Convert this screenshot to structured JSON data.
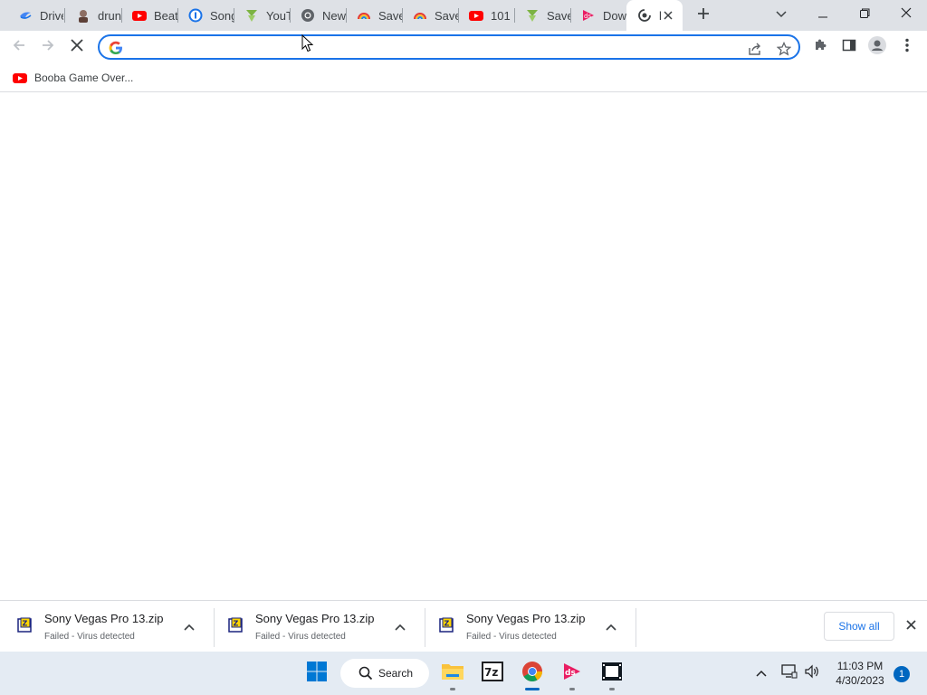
{
  "tabs": [
    {
      "label": "Drive",
      "icon": "drive-icon"
    },
    {
      "label": "drunk",
      "icon": "avatar-icon"
    },
    {
      "label": "Beat",
      "icon": "youtube-icon"
    },
    {
      "label": "Song",
      "icon": "onepassword-icon"
    },
    {
      "label": "YouT",
      "icon": "download-arrow-icon"
    },
    {
      "label": "New",
      "icon": "chrome-icon"
    },
    {
      "label": "Save",
      "icon": "rainbow-icon"
    },
    {
      "label": "Save",
      "icon": "rainbow-icon"
    },
    {
      "label": "101",
      "icon": "youtube-icon"
    },
    {
      "label": "Save",
      "icon": "download-arrow-icon"
    },
    {
      "label": "Dow",
      "icon": "ds-icon"
    },
    {
      "label": "l",
      "icon": "loading-icon",
      "active": true
    }
  ],
  "omnibox": {
    "value": "",
    "placeholder": ""
  },
  "bookmarks": [
    {
      "label": "Booba Game Over...",
      "icon": "youtube-icon"
    }
  ],
  "downloads": [
    {
      "name": "Sony Vegas Pro 13.zip",
      "status": "Failed - Virus detected"
    },
    {
      "name": "Sony Vegas Pro 13.zip",
      "status": "Failed - Virus detected"
    },
    {
      "name": "Sony Vegas Pro 13.zip",
      "status": "Failed - Virus detected"
    }
  ],
  "shelf": {
    "show_all_label": "Show all"
  },
  "taskbar": {
    "search_label": "Search",
    "time": "11:03 PM",
    "date": "4/30/2023",
    "notification_count": "1"
  },
  "colors": {
    "accent": "#1a73e8",
    "youtube": "#ff0000",
    "taskbar": "#e4ebf3",
    "tabstrip": "#dee1e6"
  }
}
